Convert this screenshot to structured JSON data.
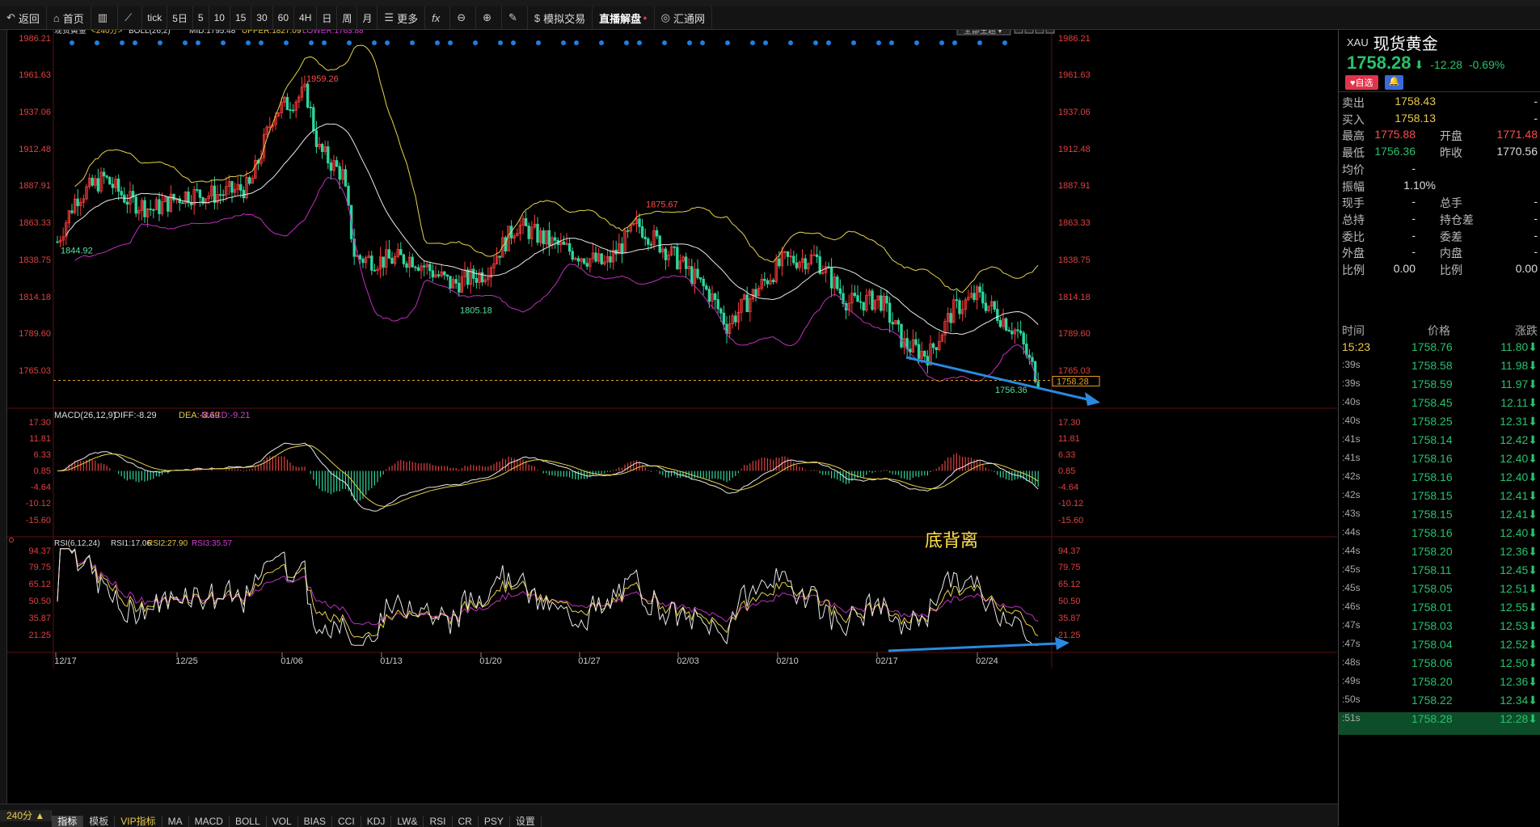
{
  "toolbar": {
    "items": [
      "返回",
      "首页",
      "",
      "tick",
      "5日",
      "5",
      "10",
      "15",
      "30",
      "60",
      "4H",
      "日",
      "周",
      "月",
      "更多",
      "",
      "",
      "",
      "",
      "模拟交易",
      "直播解盘",
      "汇通网"
    ]
  },
  "chart": {
    "header": {
      "symbol": "现货黄金",
      "period": "<240分>",
      "indicator": "BOLL(26,2)",
      "mid": "MID:1795.48",
      "upper": "UPPER:1827.09",
      "lower": "LOWER:1763.88"
    },
    "theme_btn": "全部主题▼",
    "price_axis": [
      "1986.21",
      "1961.63",
      "1937.06",
      "1912.48",
      "1887.91",
      "1863.33",
      "1838.75",
      "1814.18",
      "1789.60",
      "1765.03"
    ],
    "last_price": "1758.28",
    "annotations": {
      "high1": "1959.26",
      "high2": "1875.67",
      "low1": "1844.92",
      "low2": "1805.18",
      "low3": "1756.36"
    },
    "macd_header": {
      "name": "MACD(26,12,9)",
      "diff": "DIFF:-8.29",
      "dea": "DEA:-3.69",
      "macd": "MACD:-9.21"
    },
    "macd_axis": [
      "17.30",
      "11.81",
      "6.33",
      "0.85",
      "-4.64",
      "-10.12",
      "-15.60"
    ],
    "rsi_header": {
      "name": "RSI(6,12,24)",
      "rsi1": "RSI1:17.06",
      "rsi2": "RSI2:27.90",
      "rsi3": "RSI3:35.57"
    },
    "rsi_axis": [
      "94.37",
      "79.75",
      "65.12",
      "50.50",
      "35.87",
      "21.25"
    ],
    "divergence_label": "底背离",
    "dates": [
      "12/17",
      "12/25",
      "01/06",
      "01/13",
      "01/20",
      "01/27",
      "02/03",
      "02/10",
      "02/17",
      "02/24"
    ]
  },
  "quote": {
    "code": "XAU",
    "name": "现货黄金",
    "price": "1758.28",
    "arrow": "⬇",
    "change": "-12.28",
    "pct": "-0.69%",
    "btn_fav": "♥自选",
    "rows": [
      {
        "l1": "卖出",
        "v1": "1758.43",
        "l2": "",
        "v2": "-"
      },
      {
        "l1": "买入",
        "v1": "1758.13",
        "l2": "",
        "v2": "-"
      },
      {
        "l1": "最高",
        "v1": "1775.88",
        "l2": "开盘",
        "v2": "1771.48"
      },
      {
        "l1": "最低",
        "v1": "1756.36",
        "l2": "昨收",
        "v2": "1770.56"
      },
      {
        "l1": "均价",
        "v1": "-",
        "l2": "",
        "v2": ""
      },
      {
        "l1": "振幅",
        "v1": "1.10%",
        "l2": "",
        "v2": ""
      },
      {
        "l1": "现手",
        "v1": "-",
        "l2": "总手",
        "v2": "-"
      },
      {
        "l1": "总持",
        "v1": "-",
        "l2": "持仓差",
        "v2": "-"
      },
      {
        "l1": "委比",
        "v1": "-",
        "l2": "委差",
        "v2": "-"
      },
      {
        "l1": "外盘",
        "v1": "-",
        "l2": "内盘",
        "v2": "-"
      },
      {
        "l1": "比例",
        "v1": "0.00",
        "l2": "比例",
        "v2": "0.00"
      }
    ],
    "tick_head": {
      "time": "时间",
      "price": "价格",
      "chg": "涨跌"
    },
    "ticks": [
      {
        "t": "15:23",
        "p": "1758.76",
        "v": "11.80⬇"
      },
      {
        "t": ":39s",
        "p": "1758.58",
        "v": "11.98⬇"
      },
      {
        "t": ":39s",
        "p": "1758.59",
        "v": "11.97⬇"
      },
      {
        "t": ":40s",
        "p": "1758.45",
        "v": "12.11⬇"
      },
      {
        "t": ":40s",
        "p": "1758.25",
        "v": "12.31⬇"
      },
      {
        "t": ":41s",
        "p": "1758.14",
        "v": "12.42⬇"
      },
      {
        "t": ":41s",
        "p": "1758.16",
        "v": "12.40⬇"
      },
      {
        "t": ":42s",
        "p": "1758.16",
        "v": "12.40⬇"
      },
      {
        "t": ":42s",
        "p": "1758.15",
        "v": "12.41⬇"
      },
      {
        "t": ":43s",
        "p": "1758.15",
        "v": "12.41⬇"
      },
      {
        "t": ":44s",
        "p": "1758.16",
        "v": "12.40⬇"
      },
      {
        "t": ":44s",
        "p": "1758.20",
        "v": "12.36⬇"
      },
      {
        "t": ":45s",
        "p": "1758.11",
        "v": "12.45⬇"
      },
      {
        "t": ":45s",
        "p": "1758.05",
        "v": "12.51⬇"
      },
      {
        "t": ":46s",
        "p": "1758.01",
        "v": "12.55⬇"
      },
      {
        "t": ":47s",
        "p": "1758.03",
        "v": "12.53⬇"
      },
      {
        "t": ":47s",
        "p": "1758.04",
        "v": "12.52⬇"
      },
      {
        "t": ":48s",
        "p": "1758.06",
        "v": "12.50⬇"
      },
      {
        "t": ":49s",
        "p": "1758.20",
        "v": "12.36⬇"
      },
      {
        "t": ":50s",
        "p": "1758.22",
        "v": "12.34⬇"
      },
      {
        "t": ":51s",
        "p": "1758.28",
        "v": "12.28⬇"
      }
    ]
  },
  "bottom": {
    "period": "240分 ▲",
    "tabs_row1": [
      "指标",
      "模板",
      "VIP指标",
      "MA",
      "MACD",
      "BOLL",
      "VOL",
      "BIAS",
      "CCI",
      "KDJ",
      "LW&",
      "RSI",
      "CR",
      "PSY",
      "设置"
    ]
  }
}
